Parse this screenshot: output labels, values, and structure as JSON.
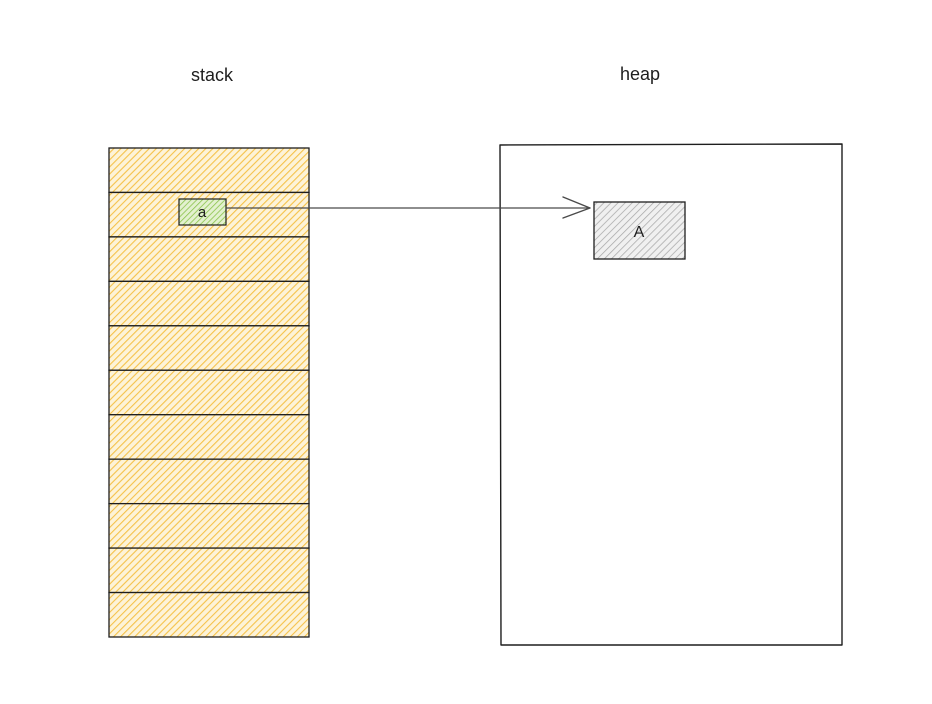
{
  "titles": {
    "stack": "stack",
    "heap": "heap"
  },
  "stack": {
    "slot_count": 11,
    "variable": {
      "label": "a",
      "slot_index": 1
    }
  },
  "heap": {
    "object": {
      "label": "A"
    }
  },
  "colors": {
    "stroke": "#1e1e1e",
    "stack_fill": "#f5c24a",
    "variable_fill": "#8bc34a",
    "object_fill": "#9a9a9a",
    "arrow": "#4a4a4a"
  }
}
